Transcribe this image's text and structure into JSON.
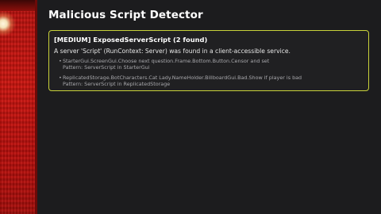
{
  "game_scene": {
    "description_icon": "red-carpet-scene"
  },
  "panel": {
    "title": "Malicious Script Detector"
  },
  "findings_card": {
    "accent_color": "#c9d23a",
    "header": "[MEDIUM] ExposedServerScript (2 found)",
    "description": "A server 'Script' (RunContext: Server) was found in a client-accessible service.",
    "items": [
      {
        "bullet": "•",
        "path": "StarterGui.ScreenGui.Choose next question.Frame.Bottom.Button.Censor and set",
        "pattern": "Pattern: ServerScript in StarterGui"
      },
      {
        "bullet": "•",
        "path": "ReplicatedStorage.BotCharacters.Cat Lady.NameHolder.BillboardGui.Bad.Show if player is bad",
        "pattern": "Pattern: ServerScript in ReplicatedStorage"
      }
    ]
  }
}
